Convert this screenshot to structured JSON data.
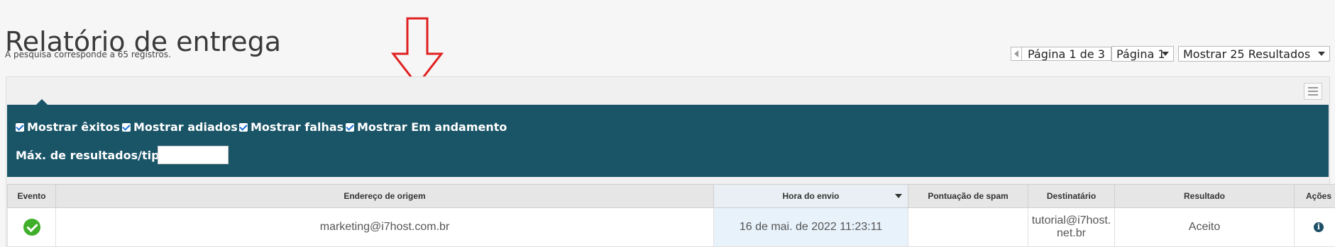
{
  "page": {
    "title": "Relatório de entrega",
    "result_count": "A pesquisa corresponde a 65 registros."
  },
  "pager": {
    "label": "Página 1 de 3",
    "page_select": "Página 1",
    "results_select": "Mostrar 25 Resultados"
  },
  "filters": {
    "show_success": "Mostrar êxitos",
    "show_deferred": "Mostrar adiados",
    "show_failures": "Mostrar falhas",
    "show_in_progress": "Mostrar Em andamento",
    "max_results_label": "Máx. de resultados/tipo:",
    "max_results_value": ""
  },
  "table": {
    "columns": [
      "Evento",
      "Endereço de origem",
      "Hora do envio",
      "Pontuação de spam",
      "Destinatário",
      "Resultado",
      "Ações"
    ],
    "rows": [
      {
        "event": "success-icon",
        "origin": "marketing@i7host.com.br",
        "sent_time": "16 de mai. de 2022 11:23:11",
        "spam_score": "",
        "recipient": "tutorial@i7host.net.br",
        "result": "Aceito",
        "action": "info-icon"
      }
    ]
  },
  "colors": {
    "filter_bar": "#195467",
    "success": "#3fae29",
    "annotation_arrow": "#e02020"
  }
}
